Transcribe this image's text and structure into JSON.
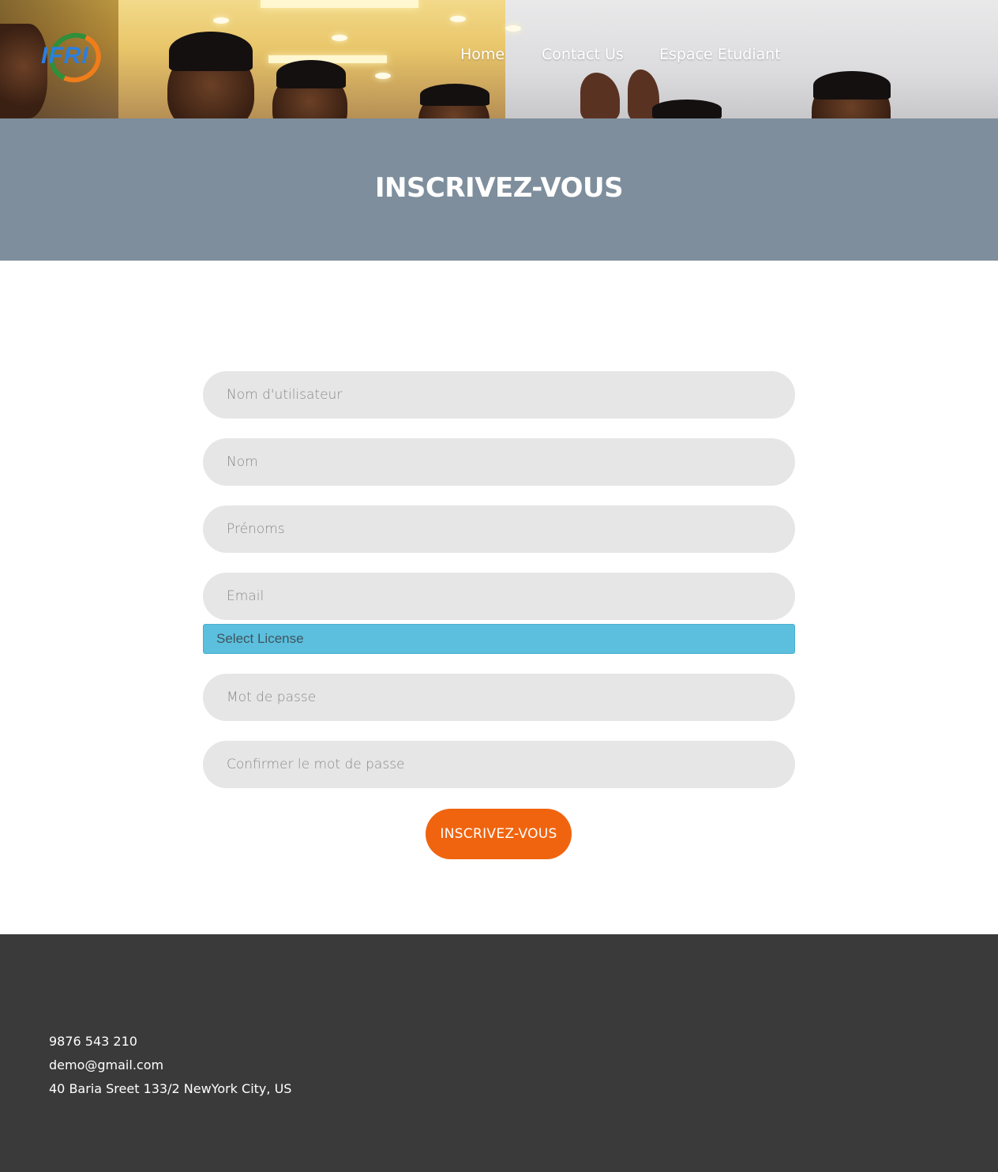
{
  "header": {
    "logo_text": "IFRI",
    "nav": [
      {
        "label": "Home"
      },
      {
        "label": "Contact Us"
      },
      {
        "label": "Espace Etudiant"
      }
    ]
  },
  "page_title": "INSCRIVEZ-VOUS",
  "form": {
    "username_placeholder": "Nom d'utilisateur",
    "lastname_placeholder": "Nom",
    "firstname_placeholder": "Prénoms",
    "email_placeholder": "Email",
    "license_select_value": "Select License",
    "password_placeholder": "Mot de passe",
    "confirm_password_placeholder": "Confirmer le mot de passe",
    "submit_label": "INSCRIVEZ-VOUS"
  },
  "footer": {
    "phone": "9876 543 210",
    "email": "demo@gmail.com",
    "address": "40 Baria Sreet 133/2 NewYork City, US"
  },
  "colors": {
    "title_band": "#7e8e9c",
    "input_bg": "#e6e6e6",
    "select_bg": "#5bbfdd",
    "button_orange": "#f0640f",
    "footer_bg": "#3a3a3a"
  }
}
